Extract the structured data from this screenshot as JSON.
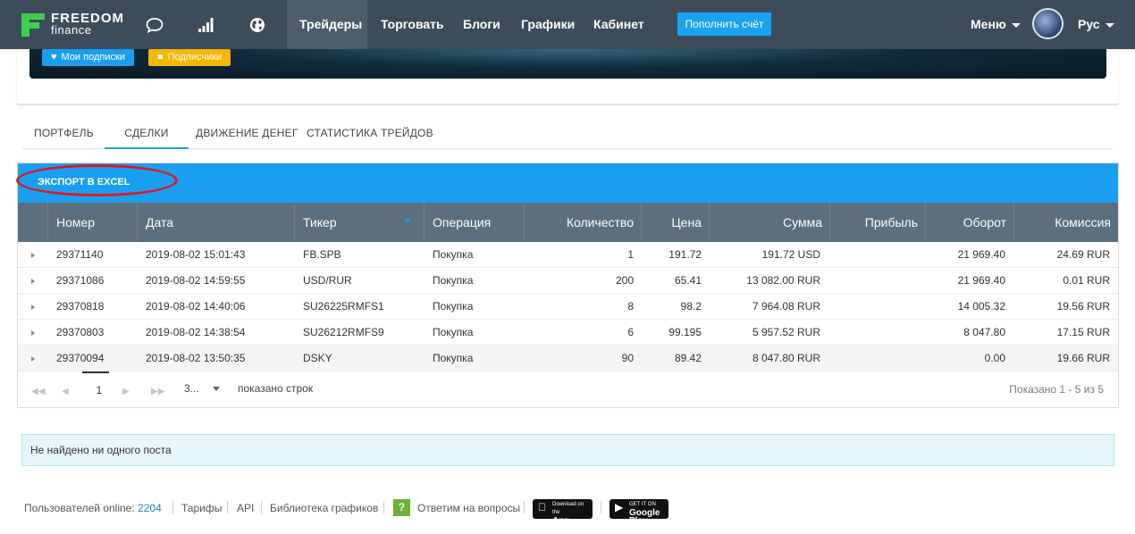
{
  "brand": {
    "name": "FREEDOM",
    "sub": "finance",
    "color": "#3ecf4c"
  },
  "nav": {
    "items": [
      {
        "label": "Трейдеры",
        "active": true
      },
      {
        "label": "Торговать"
      },
      {
        "label": "Блоги"
      },
      {
        "label": "Графики"
      },
      {
        "label": "Кабинет"
      }
    ],
    "topup": "Пополнить счёт",
    "menu": "Меню",
    "lang": "Рус",
    "icons": [
      "chat-icon",
      "signal-bars-icon",
      "globe-icon"
    ]
  },
  "banner": {
    "subscriptions": "Мои подписки",
    "followers": "Подписчики"
  },
  "tabs": [
    "ПОРТФЕЛЬ",
    "СДЕЛКИ",
    "ДВИЖЕНИЕ ДЕНЕГ",
    "СТАТИСТИКА ТРЕЙДОВ"
  ],
  "active_tab": "СДЕЛКИ",
  "toolbar": {
    "export": "ЭКСПОРТ В EXCEL"
  },
  "table": {
    "columns": [
      "Номер",
      "Дата",
      "Тикер",
      "Операция",
      "Количество",
      "Цена",
      "Сумма",
      "Прибыль",
      "Оборот",
      "Комиссия"
    ],
    "sorted_column": "Тикер",
    "rows": [
      {
        "num": "29371140",
        "date": "2019-08-02 15:01:43",
        "ticker": "FB.SPB",
        "op": "Покупка",
        "qty": "1",
        "price": "191.72",
        "sum": "191.72 USD",
        "profit": "",
        "turnover": "21 969.40",
        "fee": "24.69 RUR"
      },
      {
        "num": "29371086",
        "date": "2019-08-02 14:59:55",
        "ticker": "USD/RUR",
        "op": "Покупка",
        "qty": "200",
        "price": "65.41",
        "sum": "13 082.00 RUR",
        "profit": "",
        "turnover": "21 969.40",
        "fee": "0.01 RUR"
      },
      {
        "num": "29370818",
        "date": "2019-08-02 14:40:06",
        "ticker": "SU26225RMFS1",
        "op": "Покупка",
        "qty": "8",
        "price": "98.2",
        "sum": "7 964.08 RUR",
        "profit": "",
        "turnover": "14 005.32",
        "fee": "19.56 RUR"
      },
      {
        "num": "29370803",
        "date": "2019-08-02 14:38:54",
        "ticker": "SU26212RMFS9",
        "op": "Покупка",
        "qty": "6",
        "price": "99.195",
        "sum": "5 957.52 RUR",
        "profit": "",
        "turnover": "8 047.80",
        "fee": "17.15 RUR"
      },
      {
        "num": "29370094",
        "date": "2019-08-02 13:50:35",
        "ticker": "DSKY",
        "op": "Покупка",
        "qty": "90",
        "price": "89.42",
        "sum": "8 047.80 RUR",
        "profit": "",
        "turnover": "0.00",
        "fee": "19.66 RUR"
      }
    ]
  },
  "pager": {
    "page": "1",
    "page_size": "3...",
    "rows_label": "показано строк",
    "info": "Показано 1 - 5 из 5"
  },
  "alert": "Не найдено ни одного поста",
  "footer": {
    "online_label": "Пользователей online:",
    "online_count": "2204",
    "links": [
      "Тарифы",
      "API",
      "Библиотека графиков"
    ],
    "qa": "Ответим на вопросы",
    "qa_icon": "?",
    "appstore_small": "Download on the",
    "appstore_big": "App Store",
    "gplay_small": "GET IT ON",
    "gplay_big": "Google Play"
  },
  "colors": {
    "accent": "#1a9ff0",
    "nav_bg": "#3d4c5a",
    "header_bg": "#5b6f7e",
    "highlight_oval": "#d81a22"
  }
}
